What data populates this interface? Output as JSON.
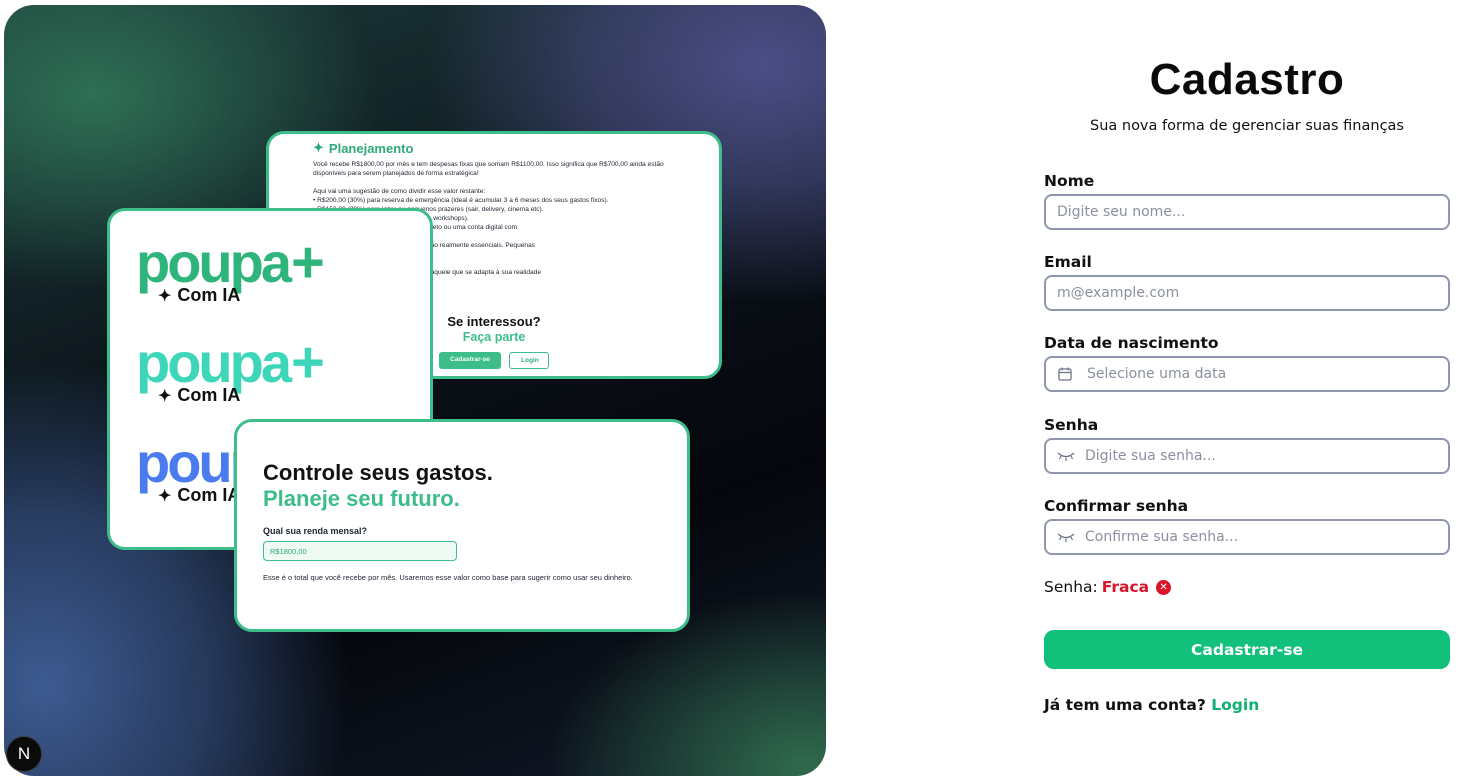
{
  "hero": {
    "plan_card": {
      "title": "Planejamento",
      "lines": [
        "Você recebe R$1800,00 por mês e tem despesas fixas que somam R$1100,00. Isso significa que R$700,00 ainda estão",
        "disponíveis para serem planejados de forma estratégica!",
        "",
        "Aqui vai uma sugestão de como dividir esse valor restante:",
        "• R$200,00 (30%) para reserva de emergência (ideal é acumular 3 a 6 meses dos seus gastos fixos).",
        "• R$150,00 (20%) para lazer ou pequenos prazeres (sair, delivery, cinema etc).",
        "                                  desenvolvimento pessoal (livros, cursos, workshops).",
        "                                  investimentos simples, como Tesouro Direto ou uma conta digital com",
        "",
        "                                  car se os \"outros gastos\" de R$500,00 são realmente essenciais. Pequenas",
        "                                  a ou até acelerar seus sonhos! 🚀",
        "",
        "                                  r consistência. Um bom planejamento é aquele que se adapta à sua realidade"
      ],
      "cta_question": "Se interessou?",
      "cta_answer": "Faça parte",
      "signup_button": "Cadastrar-se",
      "login_button": "Login"
    },
    "logo_card": {
      "word": "poupa",
      "plus": "+",
      "sub": "Com IA",
      "colors": [
        "#2fb57c",
        "#3dd6b8",
        "#4a7cf0"
      ]
    },
    "control_card": {
      "headline": "Controle seus gastos.",
      "headline_accent": "Planeje seu futuro.",
      "question": "Qual sua renda mensal?",
      "income_value": "R$1800,00",
      "note": "Esse é o total que você recebe por mês. Usaremos esse valor como base para sugerir como usar seu dinheiro."
    },
    "badge": "N"
  },
  "form": {
    "title": "Cadastro",
    "subtitle": "Sua nova forma de gerenciar suas finanças",
    "name_label": "Nome",
    "name_placeholder": "Digite seu nome...",
    "email_label": "Email",
    "email_placeholder": "m@example.com",
    "birth_label": "Data de nascimento",
    "birth_placeholder": "Selecione uma data",
    "password_label": "Senha",
    "password_placeholder": "Digite sua senha...",
    "confirm_label": "Confirmar senha",
    "confirm_placeholder": "Confirme sua senha...",
    "strength_label": "Senha:",
    "strength_value": "Fraca",
    "submit_label": "Cadastrar-se",
    "login_prompt": "Já tem uma conta?",
    "login_link": "Login"
  },
  "colors": {
    "accent": "#10c07b",
    "danger": "#d9142b",
    "card_border": "#3dbd8a"
  }
}
